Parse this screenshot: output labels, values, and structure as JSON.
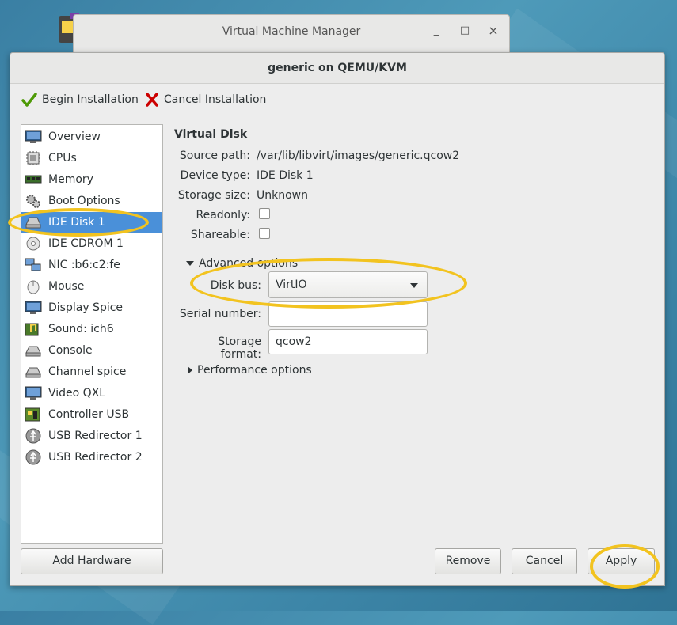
{
  "background_window": {
    "title": "Virtual Machine Manager",
    "minimize_glyph": "_",
    "maximize_glyph": "□",
    "close_glyph": "×"
  },
  "dialog": {
    "title": "generic on QEMU/KVM"
  },
  "toolbar": {
    "begin_label": "Begin Installation",
    "cancel_label": "Cancel Installation"
  },
  "sidebar": {
    "items": [
      {
        "label": "Overview",
        "icon": "monitor-icon"
      },
      {
        "label": "CPUs",
        "icon": "cpu-icon"
      },
      {
        "label": "Memory",
        "icon": "memory-icon"
      },
      {
        "label": "Boot Options",
        "icon": "gears-icon"
      },
      {
        "label": "IDE Disk 1",
        "icon": "hard-disk-icon",
        "selected": true
      },
      {
        "label": "IDE CDROM 1",
        "icon": "cdrom-icon"
      },
      {
        "label": "NIC :b6:c2:fe",
        "icon": "network-icon"
      },
      {
        "label": "Mouse",
        "icon": "mouse-icon"
      },
      {
        "label": "Display Spice",
        "icon": "display-icon"
      },
      {
        "label": "Sound: ich6",
        "icon": "sound-icon"
      },
      {
        "label": "Console",
        "icon": "serial-icon"
      },
      {
        "label": "Channel spice",
        "icon": "serial-icon"
      },
      {
        "label": "Video QXL",
        "icon": "display-icon"
      },
      {
        "label": "Controller USB",
        "icon": "controller-icon"
      },
      {
        "label": "USB Redirector 1",
        "icon": "usb-icon"
      },
      {
        "label": "USB Redirector 2",
        "icon": "usb-icon"
      }
    ],
    "add_hardware_label": "Add Hardware"
  },
  "details": {
    "section_title": "Virtual Disk",
    "source_path_label": "Source path:",
    "source_path_value": "/var/lib/libvirt/images/generic.qcow2",
    "device_type_label": "Device type:",
    "device_type_value": "IDE Disk 1",
    "storage_size_label": "Storage size:",
    "storage_size_value": "Unknown",
    "readonly_label": "Readonly:",
    "readonly_checked": false,
    "shareable_label": "Shareable:",
    "shareable_checked": false,
    "advanced_label": "Advanced options",
    "disk_bus_label": "Disk bus:",
    "disk_bus_value": "VirtIO",
    "serial_label": "Serial number:",
    "serial_value": "",
    "storage_format_label": "Storage format:",
    "storage_format_value": "qcow2",
    "performance_label": "Performance options"
  },
  "buttons": {
    "remove": "Remove",
    "cancel": "Cancel",
    "apply": "Apply"
  },
  "colors": {
    "selection": "#4a90d9",
    "annotation": "#f2c31f"
  }
}
